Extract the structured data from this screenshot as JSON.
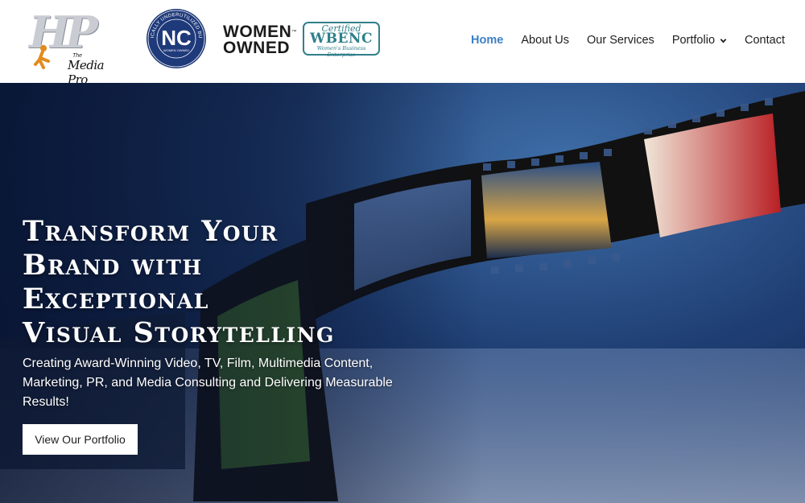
{
  "header": {
    "logo": {
      "script": "HP",
      "the": "The",
      "name": "Media Pro"
    },
    "badges": {
      "nc_seal": {
        "ring_text": "HISTORICALLY UNDERUTILIZED BUSINESS",
        "center": "NC",
        "bottom": "WOMEN OWNED"
      },
      "women_owned": {
        "line1": "WOMEN",
        "line2": "OWNED",
        "tm": "™"
      },
      "wbenc": {
        "certified": "Certified",
        "name": "WBENC",
        "sub": "Women's Business Enterprise"
      }
    },
    "nav": [
      {
        "label": "Home",
        "active": true
      },
      {
        "label": "About Us"
      },
      {
        "label": "Our Services"
      },
      {
        "label": "Portfolio",
        "has_dropdown": true
      },
      {
        "label": "Contact"
      }
    ]
  },
  "hero": {
    "title_lines": [
      "Transform Your",
      "Brand with",
      "Exceptional",
      "Visual Storytelling"
    ],
    "subtitle": "Creating Award-Winning Video, TV, Film, Multimedia Content, Marketing, PR, and Media Consulting and Delivering Measurable Results!",
    "cta": "View Our Portfolio"
  },
  "colors": {
    "nav_active": "#3d7fc4",
    "nav_text": "#1e1e1e",
    "hero_bg": "#1f3f74",
    "wbenc": "#2f7f8a",
    "nc_seal": "#1f3a7a"
  }
}
